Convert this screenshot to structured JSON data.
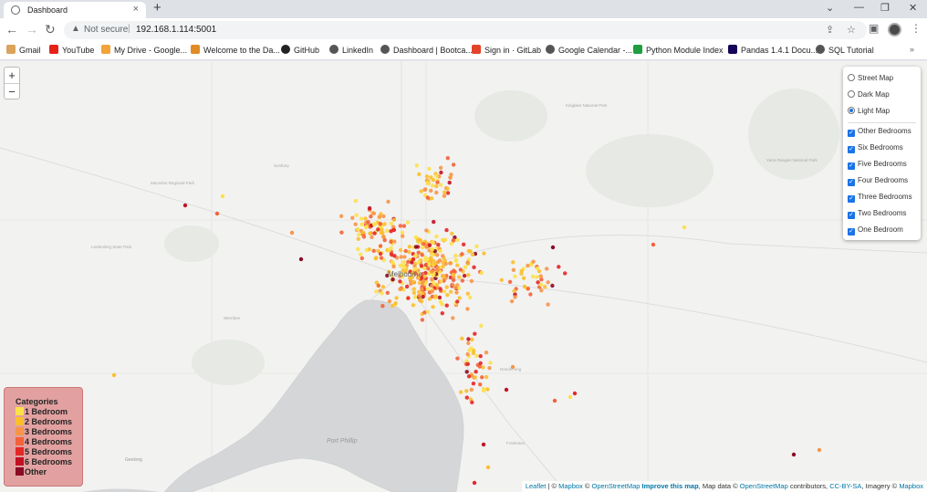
{
  "browser": {
    "tab_title": "Dashboard",
    "url_warning": "Not secure",
    "url": "192.168.1.114:5001",
    "bookmarks": [
      {
        "label": "Gmail",
        "color": "#dba35b"
      },
      {
        "label": "YouTube",
        "color": "#e62117"
      },
      {
        "label": "My Drive - Google...",
        "color": "#f2a33a"
      },
      {
        "label": "Welcome to the Da...",
        "color": "#e08b24"
      },
      {
        "label": "GitHub",
        "color": "#222222"
      },
      {
        "label": "LinkedIn",
        "color": "#555555"
      },
      {
        "label": "Dashboard | Bootca...",
        "color": "#555555"
      },
      {
        "label": "Sign in · GitLab",
        "color": "#e2432a"
      },
      {
        "label": "Google Calendar -...",
        "color": "#555555"
      },
      {
        "label": "Python Module Index",
        "color": "#1e9e3e"
      },
      {
        "label": "Pandas 1.4.1 Docu...",
        "color": "#150458"
      },
      {
        "label": "SQL Tutorial",
        "color": "#555555"
      }
    ],
    "more": "»"
  },
  "map": {
    "zoom_in": "+",
    "zoom_out": "−",
    "base_layers": [
      {
        "label": "Street Map",
        "checked": false
      },
      {
        "label": "Dark Map",
        "checked": false
      },
      {
        "label": "Light Map",
        "checked": true
      }
    ],
    "overlays": [
      {
        "label": "Other Bedrooms",
        "checked": true
      },
      {
        "label": "Six Bedrooms",
        "checked": true
      },
      {
        "label": "Five Bedrooms",
        "checked": true
      },
      {
        "label": "Four Bedrooms",
        "checked": true
      },
      {
        "label": "Three Bedrooms",
        "checked": true
      },
      {
        "label": "Two Bedrooms",
        "checked": true
      },
      {
        "label": "One Bedroom",
        "checked": true
      }
    ],
    "legend": {
      "title": "Categories",
      "items": [
        {
          "label": "1 Bedroom",
          "color": "#fde14a"
        },
        {
          "label": "2 Bedrooms",
          "color": "#fbbf2c"
        },
        {
          "label": "3 Bedrooms",
          "color": "#f79548"
        },
        {
          "label": "4 Bedrooms",
          "color": "#f4623a"
        },
        {
          "label": "5 Bedrooms",
          "color": "#e42727"
        },
        {
          "label": "6 Bedrooms",
          "color": "#c31023"
        },
        {
          "label": "Other",
          "color": "#8b0a24"
        }
      ]
    },
    "city_label": "Melbourne",
    "bay_label": "Port Phillip",
    "place_labels": [
      "Sunbury",
      "Geelong",
      "Dandenong",
      "Frankston",
      "Werribee",
      "Yarra Ranges National Park",
      "Macedon Regional Park",
      "Kinglake National Park",
      "Lerderderg State Park"
    ],
    "attribution": {
      "leaflet": "Leaflet",
      "mapbox": "Mapbox",
      "osm": "OpenStreetMap",
      "improve": "Improve this map",
      "text1": " | © ",
      "text2": " © ",
      "text3": " ",
      "text4": ", Map data © ",
      "text5": " contributors, ",
      "license": "CC-BY-SA",
      "text6": ", Imagery © "
    }
  }
}
